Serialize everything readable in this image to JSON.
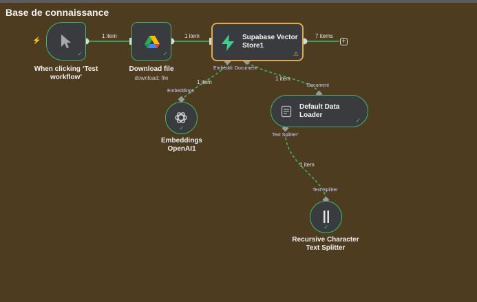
{
  "workflow": {
    "title": "Base de connaissance"
  },
  "nodes": {
    "trigger": {
      "label_line1": "When clicking ‘Test",
      "label_line2": "workflow’",
      "icon": "pointer-icon"
    },
    "download": {
      "label": "Download file",
      "sublabel": "download: file",
      "icon": "google-drive-icon"
    },
    "supabase": {
      "label_line1": "Supabase Vector",
      "label_line2": "Store1",
      "icon": "supabase-icon"
    },
    "embeddings": {
      "label_line1": "Embeddings",
      "label_line2": "OpenAI1",
      "icon": "openai-icon"
    },
    "loader": {
      "label_line1": "Default Data",
      "label_line2": "Loader",
      "icon": "document-icon"
    },
    "splitter": {
      "label_line1": "Recursive Character",
      "label_line2": "Text Splitter",
      "icon": "splitter-icon"
    }
  },
  "connections": {
    "trigger_to_download": "1 item",
    "download_to_supabase": "1 item",
    "supabase_out": "7 items",
    "embeddings_link": "1 item",
    "loader_link": "1 item",
    "splitter_link": "1 item"
  },
  "ports": {
    "supabase_embedding": "Embeddi",
    "supabase_document": "Document",
    "required_mark": "*",
    "embeddings_in": "Embeddings",
    "loader_in": "Document",
    "loader_text_splitter": "Text Splitter",
    "splitter_in": "Text Splitter"
  },
  "colors": {
    "canvas": "#4e3c21",
    "node": "#3a3b3f",
    "success": "#3eb870",
    "selected": "#e0a94a",
    "trigger_bolt": "#e0603c"
  }
}
